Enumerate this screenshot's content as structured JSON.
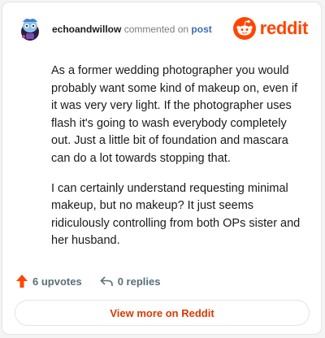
{
  "comment": {
    "author": "echoandwillow",
    "action_text": "commented on",
    "post_link": "post",
    "paragraphs": [
      "As a former wedding photographer you would probably want some kind of makeup on, even if it was very very light. If the photographer uses flash it's going to wash everybody completely out. Just a little bit of foundation and mascara can do a lot towards stopping that.",
      "I can certainly understand requesting minimal makeup, but no makeup? It just seems ridiculously controlling from both OPs sister and her husband."
    ],
    "upvotes_label": "6 upvotes",
    "replies_label": "0 replies"
  },
  "brand": {
    "name": "reddit",
    "icon": "reddit-logo-icon",
    "color": "#ff4500"
  },
  "footer": {
    "view_more_label": "View more on Reddit"
  },
  "colors": {
    "accent": "#d93a00",
    "upvote": "#ff4500",
    "link": "#3b6bb5"
  }
}
